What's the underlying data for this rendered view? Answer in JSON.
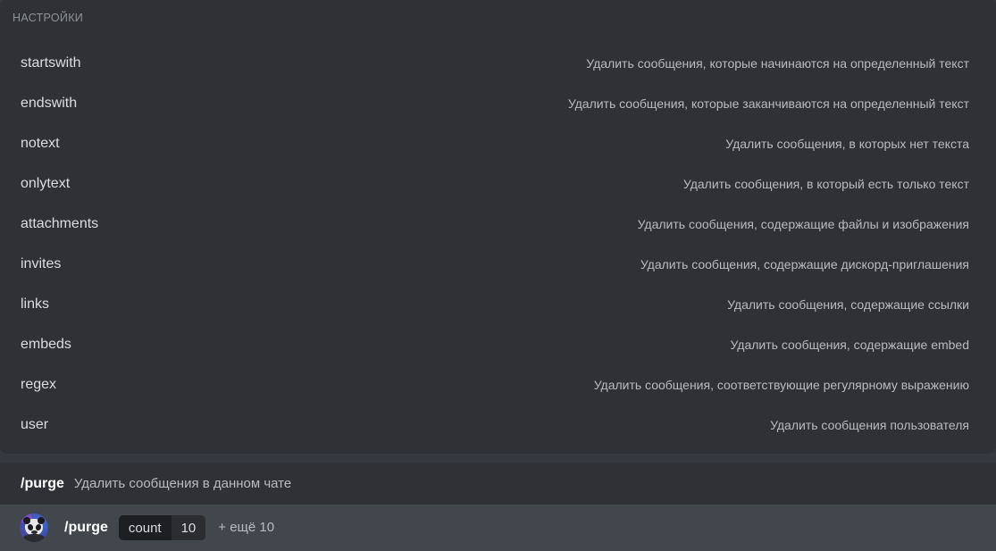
{
  "settings": {
    "header_label": "НАСТРОЙКИ",
    "options": [
      {
        "name": "startswith",
        "description": "Удалить сообщения, которые начинаются на определенный текст"
      },
      {
        "name": "endswith",
        "description": "Удалить сообщения, которые заканчиваются на определенный текст"
      },
      {
        "name": "notext",
        "description": "Удалить сообщения, в которых нет текста"
      },
      {
        "name": "onlytext",
        "description": "Удалить сообщения, в который есть только текст"
      },
      {
        "name": "attachments",
        "description": "Удалить сообщения, содержащие файлы и изображения"
      },
      {
        "name": "invites",
        "description": "Удалить сообщения, содержащие дискорд-приглашения"
      },
      {
        "name": "links",
        "description": "Удалить сообщения, содержащие ссылки"
      },
      {
        "name": "embeds",
        "description": "Удалить сообщения, содержащие embed"
      },
      {
        "name": "regex",
        "description": "Удалить сообщения, соответствующие регулярному выражению"
      },
      {
        "name": "user",
        "description": "Удалить сообщения пользователя"
      }
    ]
  },
  "command_header": {
    "command": "/purge",
    "description": "Удалить сообщения в данном чате"
  },
  "suggestion": {
    "avatar_icon": "bot-avatar-panda-icon",
    "command": "/purge",
    "param_key": "count",
    "param_value": "10",
    "more_label": "+ ещё 10"
  },
  "colors": {
    "panel_bg": "#2f3136",
    "app_bg": "#36393f",
    "row_highlight": "#42464d",
    "text_primary": "#dcddde",
    "text_muted": "#b9bbbe",
    "text_header": "#8e9297",
    "chip_key_bg": "#1e1f22",
    "chip_val_bg": "#2b2d31"
  }
}
